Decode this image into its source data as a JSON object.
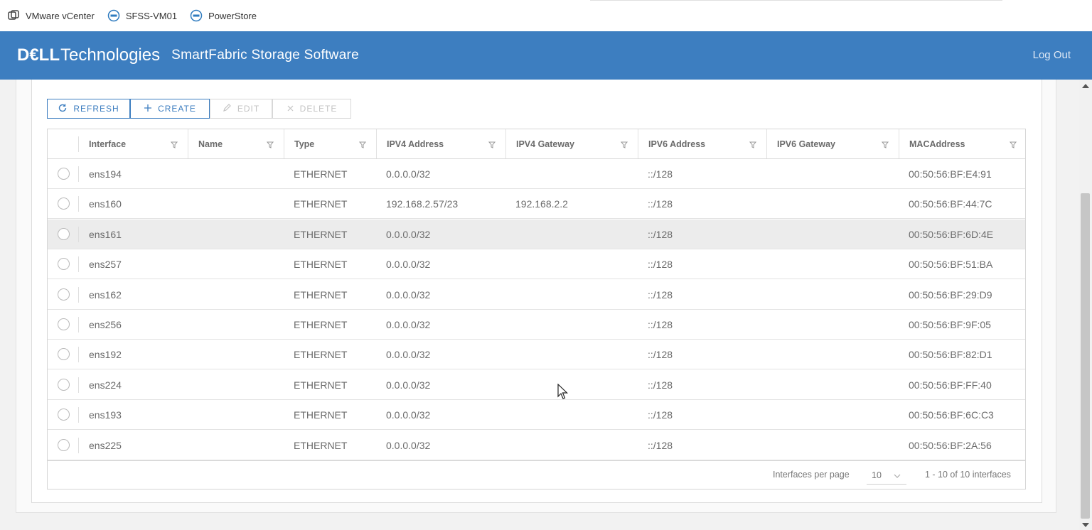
{
  "bookmarks": [
    {
      "label": "VMware vCenter",
      "icon": "vmware-icon"
    },
    {
      "label": "SFSS-VM01",
      "icon": "dell-logo-icon"
    },
    {
      "label": "PowerStore",
      "icon": "dell-logo-icon"
    }
  ],
  "header": {
    "brand_dell": "D€LL",
    "brand_tech": "Technologies",
    "app_title": "SmartFabric Storage Software",
    "logout": "Log Out",
    "color": "#3d7ec0"
  },
  "toolbar": {
    "refresh": "REFRESH",
    "create": "CREATE",
    "edit": "EDIT",
    "delete": "DELETE"
  },
  "table": {
    "columns": [
      "Interface",
      "Name",
      "Type",
      "IPV4 Address",
      "IPV4 Gateway",
      "IPV6 Address",
      "IPV6 Gateway",
      "MACAddress"
    ],
    "rows": [
      {
        "interface": "ens194",
        "name": "",
        "type": "ETHERNET",
        "ipv4": "0.0.0.0/32",
        "ipv4_gw": "",
        "ipv6": "::/128",
        "ipv6_gw": "",
        "mac": "00:50:56:BF:E4:91"
      },
      {
        "interface": "ens160",
        "name": "",
        "type": "ETHERNET",
        "ipv4": "192.168.2.57/23",
        "ipv4_gw": "192.168.2.2",
        "ipv6": "::/128",
        "ipv6_gw": "",
        "mac": "00:50:56:BF:44:7C"
      },
      {
        "interface": "ens161",
        "name": "",
        "type": "ETHERNET",
        "ipv4": "0.0.0.0/32",
        "ipv4_gw": "",
        "ipv6": "::/128",
        "ipv6_gw": "",
        "mac": "00:50:56:BF:6D:4E"
      },
      {
        "interface": "ens257",
        "name": "",
        "type": "ETHERNET",
        "ipv4": "0.0.0.0/32",
        "ipv4_gw": "",
        "ipv6": "::/128",
        "ipv6_gw": "",
        "mac": "00:50:56:BF:51:BA"
      },
      {
        "interface": "ens162",
        "name": "",
        "type": "ETHERNET",
        "ipv4": "0.0.0.0/32",
        "ipv4_gw": "",
        "ipv6": "::/128",
        "ipv6_gw": "",
        "mac": "00:50:56:BF:29:D9"
      },
      {
        "interface": "ens256",
        "name": "",
        "type": "ETHERNET",
        "ipv4": "0.0.0.0/32",
        "ipv4_gw": "",
        "ipv6": "::/128",
        "ipv6_gw": "",
        "mac": "00:50:56:BF:9F:05"
      },
      {
        "interface": "ens192",
        "name": "",
        "type": "ETHERNET",
        "ipv4": "0.0.0.0/32",
        "ipv4_gw": "",
        "ipv6": "::/128",
        "ipv6_gw": "",
        "mac": "00:50:56:BF:82:D1"
      },
      {
        "interface": "ens224",
        "name": "",
        "type": "ETHERNET",
        "ipv4": "0.0.0.0/32",
        "ipv4_gw": "",
        "ipv6": "::/128",
        "ipv6_gw": "",
        "mac": "00:50:56:BF:FF:40"
      },
      {
        "interface": "ens193",
        "name": "",
        "type": "ETHERNET",
        "ipv4": "0.0.0.0/32",
        "ipv4_gw": "",
        "ipv6": "::/128",
        "ipv6_gw": "",
        "mac": "00:50:56:BF:6C:C3"
      },
      {
        "interface": "ens225",
        "name": "",
        "type": "ETHERNET",
        "ipv4": "0.0.0.0/32",
        "ipv4_gw": "",
        "ipv6": "::/128",
        "ipv6_gw": "",
        "mac": "00:50:56:BF:2A:56"
      }
    ],
    "highlighted_row": 2
  },
  "footer": {
    "per_page_label": "Interfaces per page",
    "per_page_value": "10",
    "pager_info": "1 - 10 of 10 interfaces"
  }
}
